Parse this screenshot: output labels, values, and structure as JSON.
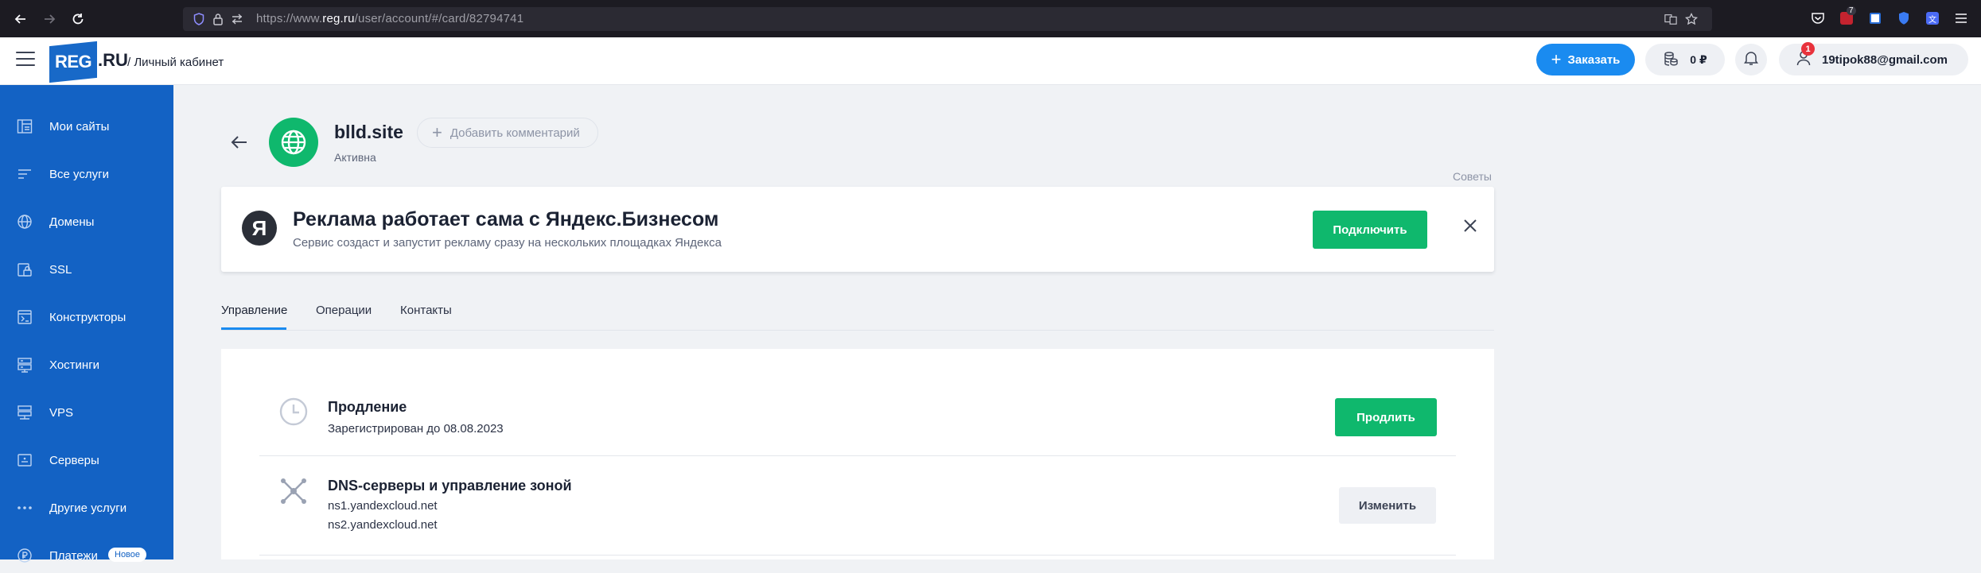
{
  "browser": {
    "url_prefix": "https://www.",
    "url_host": "reg.ru",
    "url_path": "/user/account/#/card/82794741",
    "ext_badge": "7"
  },
  "header": {
    "logo_main": "REG",
    "logo_suffix": ".RU",
    "breadcrumb": "/ Личный кабинет",
    "order_label": "Заказать",
    "balance": "0 ₽",
    "user_email": "19tipok88@gmail.com",
    "notif_count": "1"
  },
  "sidebar": {
    "items": [
      {
        "label": "Мои сайты",
        "icon": "sites-icon"
      },
      {
        "label": "Все услуги",
        "icon": "list-icon"
      },
      {
        "label": "Домены",
        "icon": "globe-icon"
      },
      {
        "label": "SSL",
        "icon": "ssl-lock-icon"
      },
      {
        "label": "Конструкторы",
        "icon": "builder-icon"
      },
      {
        "label": "Хостинги",
        "icon": "hosting-icon"
      },
      {
        "label": "VPS",
        "icon": "vps-icon"
      },
      {
        "label": "Серверы",
        "icon": "server-icon"
      },
      {
        "label": "Другие услуги",
        "icon": "more-dots-icon"
      },
      {
        "label": "Платежи",
        "icon": "payments-icon",
        "badge": "Новое"
      }
    ]
  },
  "domain": {
    "name": "blld.site",
    "status": "Активна",
    "add_comment": "Добавить комментарий"
  },
  "tips_label": "Советы",
  "promo": {
    "logo_letter": "Я",
    "title": "Реклама работает сама с Яндекс.Бизнесом",
    "subtitle": "Сервис создаст и запустит рекламу сразу на нескольких площадках Яндекса",
    "button": "Подключить"
  },
  "tabs": [
    {
      "label": "Управление",
      "active": true
    },
    {
      "label": "Операции",
      "active": false
    },
    {
      "label": "Контакты",
      "active": false
    }
  ],
  "renewal": {
    "title": "Продление",
    "text": "Зарегистрирован до 08.08.2023",
    "button": "Продлить"
  },
  "dns": {
    "title": "DNS-серверы и управление зоной",
    "ns1": "ns1.yandexcloud.net",
    "ns2": "ns2.yandexcloud.net",
    "button": "Изменить"
  },
  "colors": {
    "brand_blue": "#1362c4",
    "accent_blue": "#1a8bf0",
    "green": "#0fb86d",
    "badge_red": "#e8323c"
  }
}
